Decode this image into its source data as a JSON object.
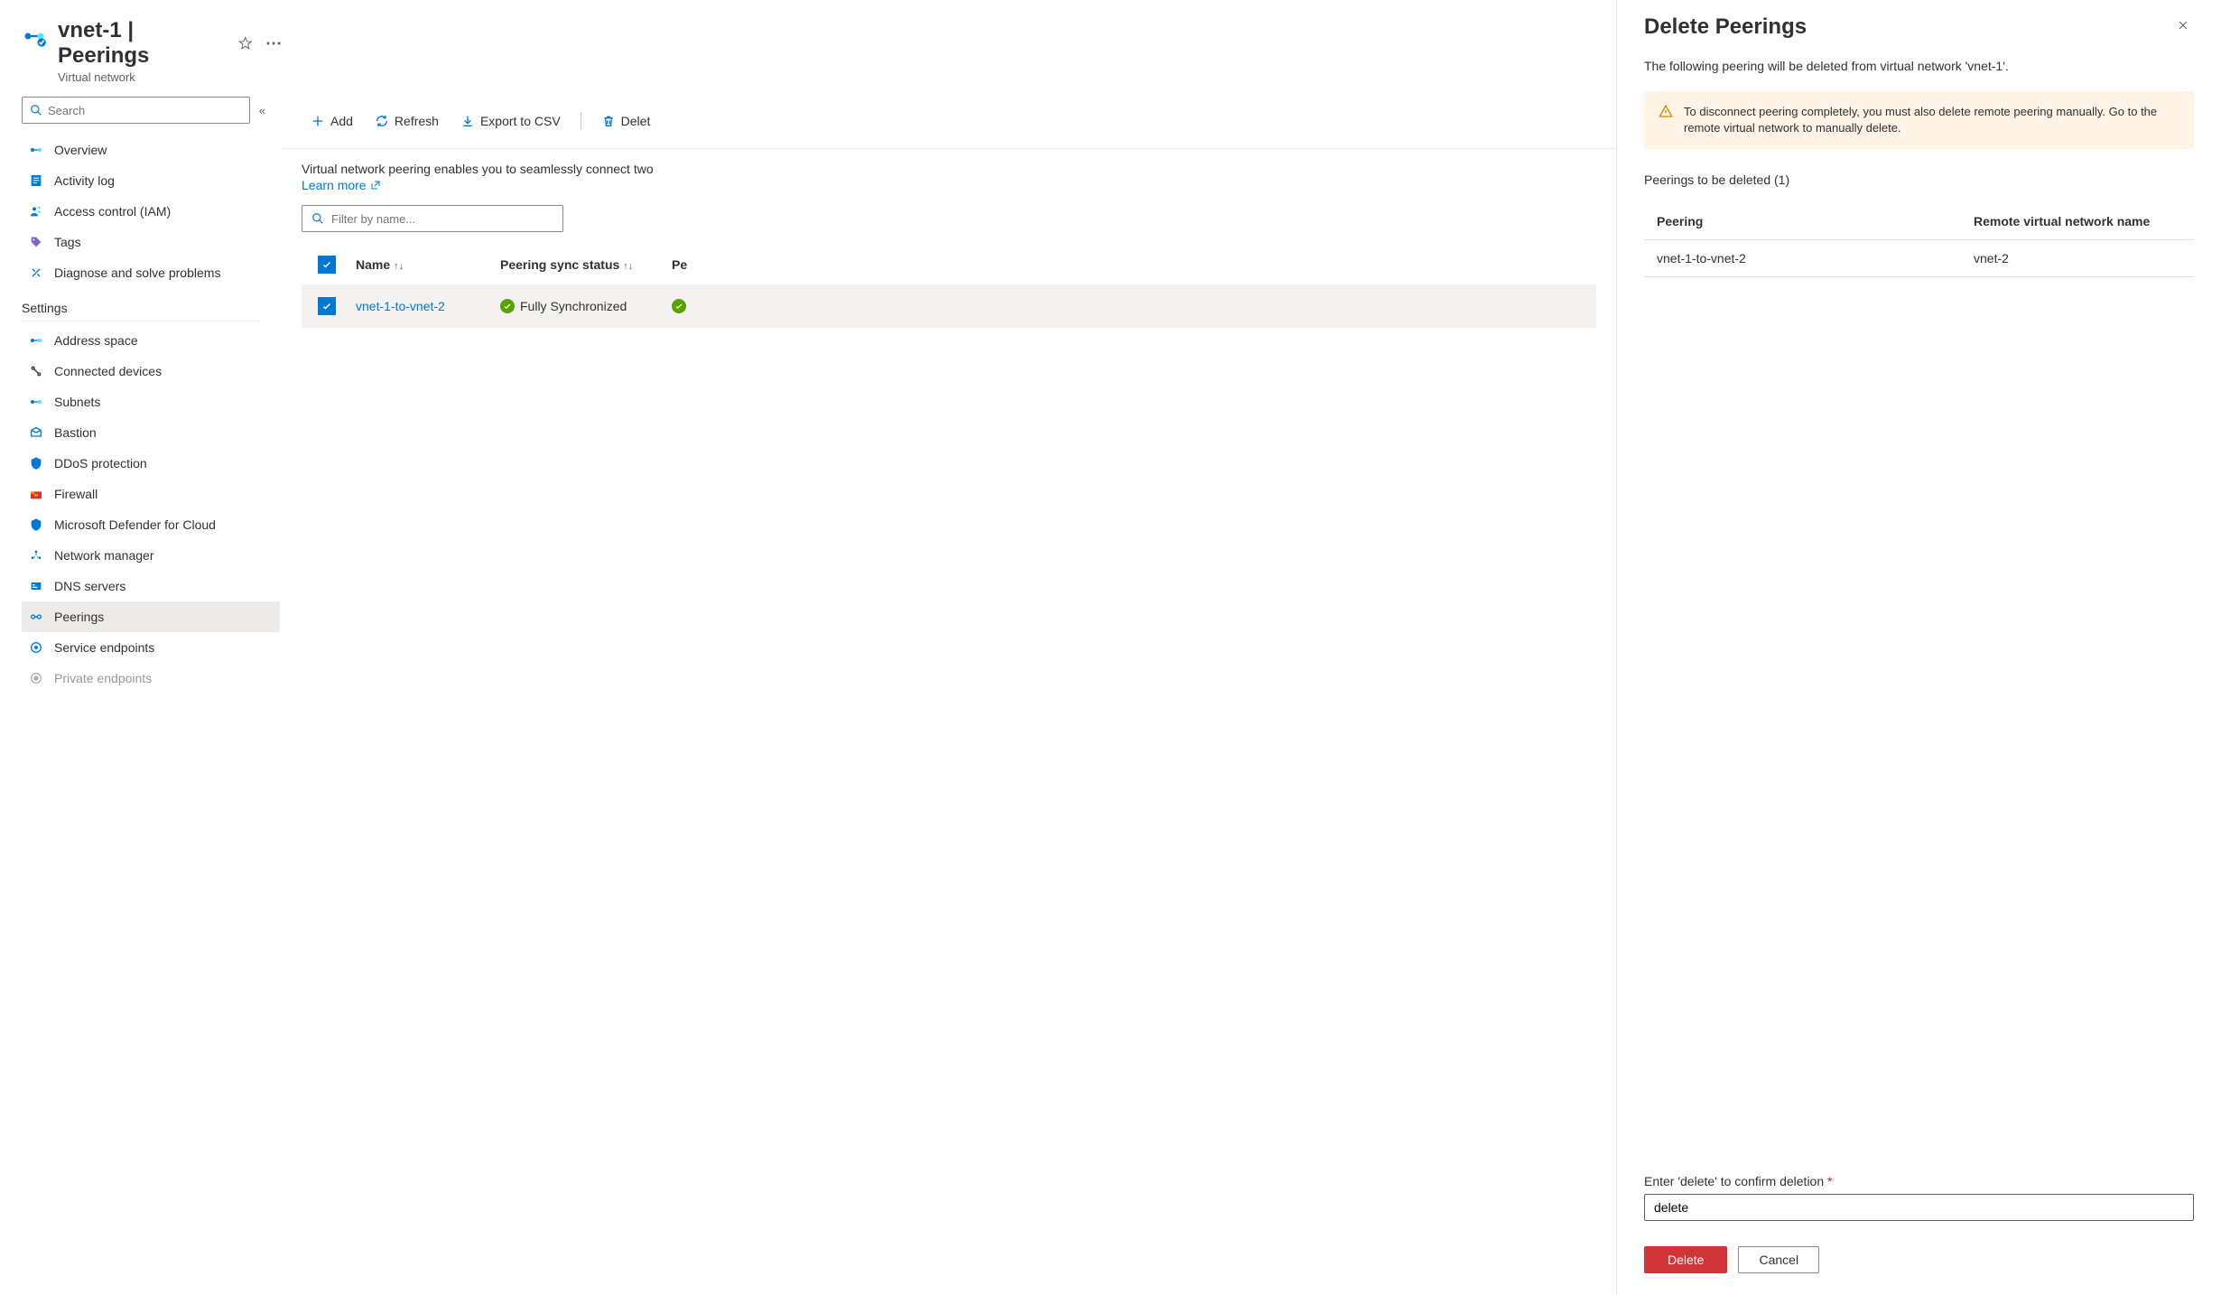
{
  "header": {
    "title": "vnet-1 | Peerings",
    "subtitle": "Virtual network"
  },
  "search": {
    "placeholder": "Search"
  },
  "nav": {
    "overview": "Overview",
    "activity_log": "Activity log",
    "access_control": "Access control (IAM)",
    "tags": "Tags",
    "diagnose": "Diagnose and solve problems",
    "settings_label": "Settings",
    "address_space": "Address space",
    "connected_devices": "Connected devices",
    "subnets": "Subnets",
    "bastion": "Bastion",
    "ddos": "DDoS protection",
    "firewall": "Firewall",
    "defender": "Microsoft Defender for Cloud",
    "network_manager": "Network manager",
    "dns_servers": "DNS servers",
    "peerings": "Peerings",
    "service_endpoints": "Service endpoints",
    "private_endpoints": "Private endpoints"
  },
  "toolbar": {
    "add": "Add",
    "refresh": "Refresh",
    "export": "Export to CSV",
    "delete": "Delet"
  },
  "main": {
    "description": "Virtual network peering enables you to seamlessly connect two",
    "learn_more": "Learn more",
    "filter_placeholder": "Filter by name...",
    "col_name": "Name",
    "col_sync": "Peering sync status",
    "col_status": "Pe",
    "row_name": "vnet-1-to-vnet-2",
    "row_sync": "Fully Synchronized"
  },
  "panel": {
    "title": "Delete Peerings",
    "description": "The following peering will be deleted from virtual network 'vnet-1'.",
    "warning": "To disconnect peering completely, you must also delete remote peering manually. Go to the remote virtual network to manually delete.",
    "to_delete_label": "Peerings to be deleted (1)",
    "col_peering": "Peering",
    "col_remote": "Remote virtual network name",
    "row_peering": "vnet-1-to-vnet-2",
    "row_remote": "vnet-2",
    "confirm_label": "Enter 'delete' to confirm deletion",
    "confirm_value": "delete",
    "delete_btn": "Delete",
    "cancel_btn": "Cancel"
  }
}
